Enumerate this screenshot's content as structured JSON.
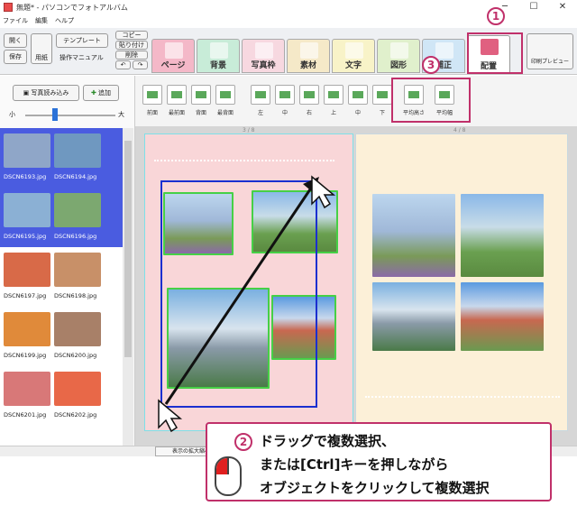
{
  "window": {
    "title": "無題* - パソコンでフォトアルバム"
  },
  "menu": [
    "ファイル",
    "編集",
    "ヘルプ"
  ],
  "toolbar": {
    "open": "開く",
    "save": "保存",
    "paper": "用紙",
    "template": "テンプレート",
    "manual": "操作マニュアル",
    "copy": "コピー",
    "paste": "貼り付け",
    "delete": "削除",
    "print_preview": "印刷プレビュー"
  },
  "tabs": [
    {
      "label": "ページ",
      "color": "#f4b8c8"
    },
    {
      "label": "背景",
      "color": "#c8ecd8"
    },
    {
      "label": "写真枠",
      "color": "#f7d8e0"
    },
    {
      "label": "素材",
      "color": "#f5e9c8"
    },
    {
      "label": "文字",
      "color": "#f8f3c8"
    },
    {
      "label": "図形",
      "color": "#e0f0cc"
    },
    {
      "label": "補正",
      "color": "#d0e6f6"
    },
    {
      "label": "配置",
      "color": "#ffffff"
    }
  ],
  "arrange": {
    "order": [
      "前面",
      "最前面",
      "背面",
      "最背面"
    ],
    "align": [
      "左",
      "中",
      "右",
      "上",
      "中",
      "下"
    ],
    "size": [
      "平均高さ",
      "平均幅"
    ]
  },
  "left": {
    "load_photos": "写真読み込み",
    "add": "追加",
    "small": "小",
    "large": "大",
    "thumbs": [
      {
        "name": "DSCN6193.jpg",
        "color": "#8fa6c8"
      },
      {
        "name": "DSCN6194.jpg",
        "color": "#6f98c0"
      },
      {
        "name": "DSCN6195.jpg",
        "color": "#8bb0d4"
      },
      {
        "name": "DSCN6196.jpg",
        "color": "#7ca870"
      },
      {
        "name": "DSCN6197.jpg",
        "color": "#d86a48"
      },
      {
        "name": "DSCN6198.jpg",
        "color": "#c89068"
      },
      {
        "name": "DSCN6199.jpg",
        "color": "#e08a3a"
      },
      {
        "name": "DSCN6200.jpg",
        "color": "#a88068"
      },
      {
        "name": "DSCN6201.jpg",
        "color": "#d87878"
      },
      {
        "name": "DSCN6202.jpg",
        "color": "#e86848"
      }
    ]
  },
  "canvas": {
    "left_page_num": "3 / 8",
    "right_page_num": "4 / 8"
  },
  "status": {
    "zoom_label": "表示の拡大縮小"
  },
  "callout": {
    "badge": "2",
    "line1": "ドラッグで複数選択、",
    "line2": "または[Ctrl]キーを押しながら",
    "line3": "オブジェクトをクリックして複数選択"
  },
  "markers": {
    "one": "1",
    "three": "3"
  },
  "colors": {
    "accent": "#c0306a",
    "selection_green": "#46d046",
    "selection_blue": "#1a2fd0",
    "left_page": "#f9d6d8",
    "right_page": "#fcf0d8"
  }
}
